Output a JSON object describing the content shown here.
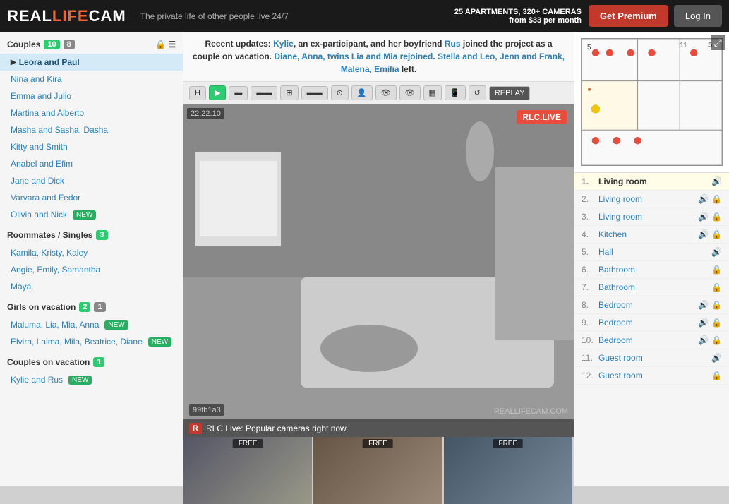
{
  "header": {
    "logo_part1": "REAL",
    "logo_part2": "LIFE",
    "logo_part3": "CAM",
    "tagline": "The private life of other people live 24/7",
    "apartments": "25 APARTMENTS, 320+ CAMERAS",
    "price": "from $33 per month",
    "btn_premium": "Get Premium",
    "btn_login": "Log In"
  },
  "sidebar": {
    "couples_label": "Couples",
    "couples_count_green": "10",
    "couples_count_gray": "8",
    "couples": [
      {
        "name": "Leora and Paul",
        "active": true
      },
      {
        "name": "Nina and Kira"
      },
      {
        "name": "Emma and Julio"
      },
      {
        "name": "Martina and Alberto"
      },
      {
        "name": "Masha and Sasha, Dasha"
      },
      {
        "name": "Kitty and Smith"
      },
      {
        "name": "Anabel and Efim"
      },
      {
        "name": "Jane and Dick"
      },
      {
        "name": "Varvara and Fedor"
      },
      {
        "name": "Olivia and Nick",
        "new": true
      }
    ],
    "roommates_label": "Roommates / Singles",
    "roommates_count": "3",
    "roommates": [
      {
        "name": "Kamila, Kristy, Kaley"
      },
      {
        "name": "Angie, Emily, Samantha"
      },
      {
        "name": "Maya"
      }
    ],
    "girls_vacation_label": "Girls on vacation",
    "girls_vacation_count_green": "2",
    "girls_vacation_count_gray": "1",
    "girls_vacation": [
      {
        "name": "Maluma, Lia, Mia, Anna",
        "new": true
      },
      {
        "name": "Elvira, Laima, Mila, Beatrice, Diane",
        "new": true
      }
    ],
    "couples_vacation_label": "Couples on vacation",
    "couples_vacation_count": "1",
    "couples_vacation": [
      {
        "name": "Kylie and Rus",
        "new": true
      }
    ]
  },
  "announcement": {
    "text": "Recent updates: Kylie, an ex-participant, and her boyfriend Rus joined the project as a couple on vacation. Diane, Anna, twins Lia and Mia rejoined. Stella and Leo, Jenn and Frank, Malena, Emilia left.",
    "names": [
      "Kylie",
      "Rus",
      "Diane",
      "Anna",
      "Lia",
      "Mia",
      "Stella",
      "Leo",
      "Jenn",
      "Frank",
      "Malena",
      "Emilia"
    ]
  },
  "toolbar": {
    "buttons": [
      "H",
      "▶",
      "▬",
      "▬▬",
      "▬▬▬",
      "▬▬▬▬",
      "▬▬▬▬▬",
      "👤",
      "👁",
      "👁‍🗨",
      "⊞",
      "📱",
      "↺",
      "REPLAY"
    ]
  },
  "video": {
    "timestamp": "22:22:10",
    "live_badge": "RLC.LIVE",
    "camera_id": "99fb1a3",
    "watermark": "REALLIFECAM.COM"
  },
  "rooms": [
    {
      "num": "1.",
      "name": "Living room",
      "active": true,
      "sound": true,
      "locked": false
    },
    {
      "num": "2.",
      "name": "Living room",
      "active": false,
      "sound": true,
      "locked": true
    },
    {
      "num": "3.",
      "name": "Living room",
      "active": false,
      "sound": true,
      "locked": true
    },
    {
      "num": "4.",
      "name": "Kitchen",
      "active": false,
      "sound": true,
      "locked": true
    },
    {
      "num": "5.",
      "name": "Hall",
      "active": false,
      "sound": true,
      "locked": false
    },
    {
      "num": "6.",
      "name": "Bathroom",
      "active": false,
      "sound": false,
      "locked": true
    },
    {
      "num": "7.",
      "name": "Bathroom",
      "active": false,
      "sound": false,
      "locked": true
    },
    {
      "num": "8.",
      "name": "Bedroom",
      "active": false,
      "sound": true,
      "locked": true
    },
    {
      "num": "9.",
      "name": "Bedroom",
      "active": false,
      "sound": true,
      "locked": true
    },
    {
      "num": "10.",
      "name": "Bedroom",
      "active": false,
      "sound": true,
      "locked": true
    },
    {
      "num": "11.",
      "name": "Guest room",
      "active": false,
      "sound": true,
      "locked": false
    },
    {
      "num": "12.",
      "name": "Guest room",
      "active": false,
      "sound": false,
      "locked": true
    }
  ],
  "bottom": {
    "rlc_label": "R",
    "title": "RLC Live: Popular cameras right now",
    "cams": [
      {
        "label": "FREE"
      },
      {
        "label": "FREE"
      },
      {
        "label": "FREE"
      }
    ]
  }
}
